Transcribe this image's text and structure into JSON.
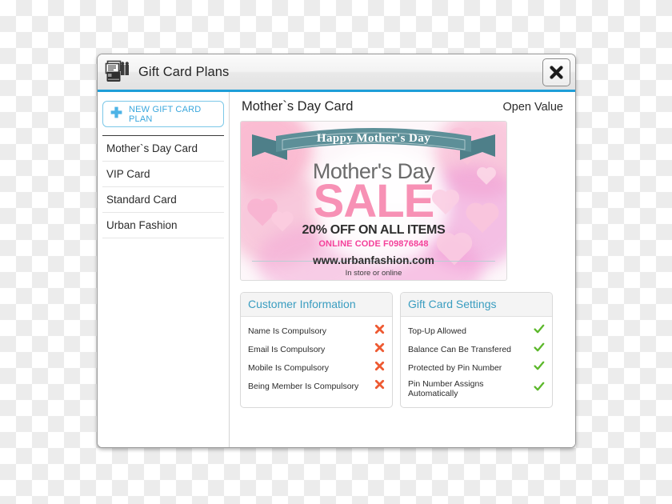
{
  "window": {
    "title": "Gift Card Plans",
    "app_icon": "gift-card-stack-icon",
    "close_icon": "close-icon",
    "accent_color": "#1e9ed8"
  },
  "sidebar": {
    "new_plan_button": {
      "label": "NEW GIFT CARD PLAN",
      "icon": "plus-icon",
      "color": "#3aa7dd"
    },
    "plans": [
      {
        "label": "Mother`s Day Card"
      },
      {
        "label": "VIP Card"
      },
      {
        "label": "Standard Card"
      },
      {
        "label": "Urban Fashion"
      }
    ]
  },
  "main": {
    "card_title": "Mother`s Day Card",
    "open_value_label": "Open Value",
    "card_art": {
      "banner_text": "Happy Mother's Day",
      "headline": "Mother's Day",
      "sale_word": "SALE",
      "offer_line": "20% OFF ON ALL ITEMS",
      "code_line": "ONLINE CODE F09876848",
      "website": "www.urbanfashion.com",
      "instore_line": "In store or online",
      "banner_color": "#5d8f98",
      "sale_color": "#f791b5",
      "code_color": "#f4409a"
    },
    "panels": [
      {
        "title": "Customer Information",
        "rows": [
          {
            "label": "Name Is Compulsory",
            "state": "off",
            "mark": "cross-icon"
          },
          {
            "label": "Email Is Compulsory",
            "state": "off",
            "mark": "cross-icon"
          },
          {
            "label": "Mobile Is Compulsory",
            "state": "off",
            "mark": "cross-icon"
          },
          {
            "label": "Being Member Is Compulsory",
            "state": "off",
            "mark": "cross-icon"
          }
        ]
      },
      {
        "title": "Gift Card Settings",
        "rows": [
          {
            "label": "Top-Up Allowed",
            "state": "on",
            "mark": "check-icon"
          },
          {
            "label": "Balance Can Be Transfered",
            "state": "on",
            "mark": "check-icon"
          },
          {
            "label": "Protected by Pin Number",
            "state": "on",
            "mark": "check-icon"
          },
          {
            "label": "Pin Number Assigns Automatically",
            "state": "on",
            "mark": "check-icon"
          }
        ]
      }
    ],
    "colors": {
      "panel_header_text": "#3a9dc0",
      "cross": "#ee5a32",
      "check": "#5cb82b"
    }
  }
}
